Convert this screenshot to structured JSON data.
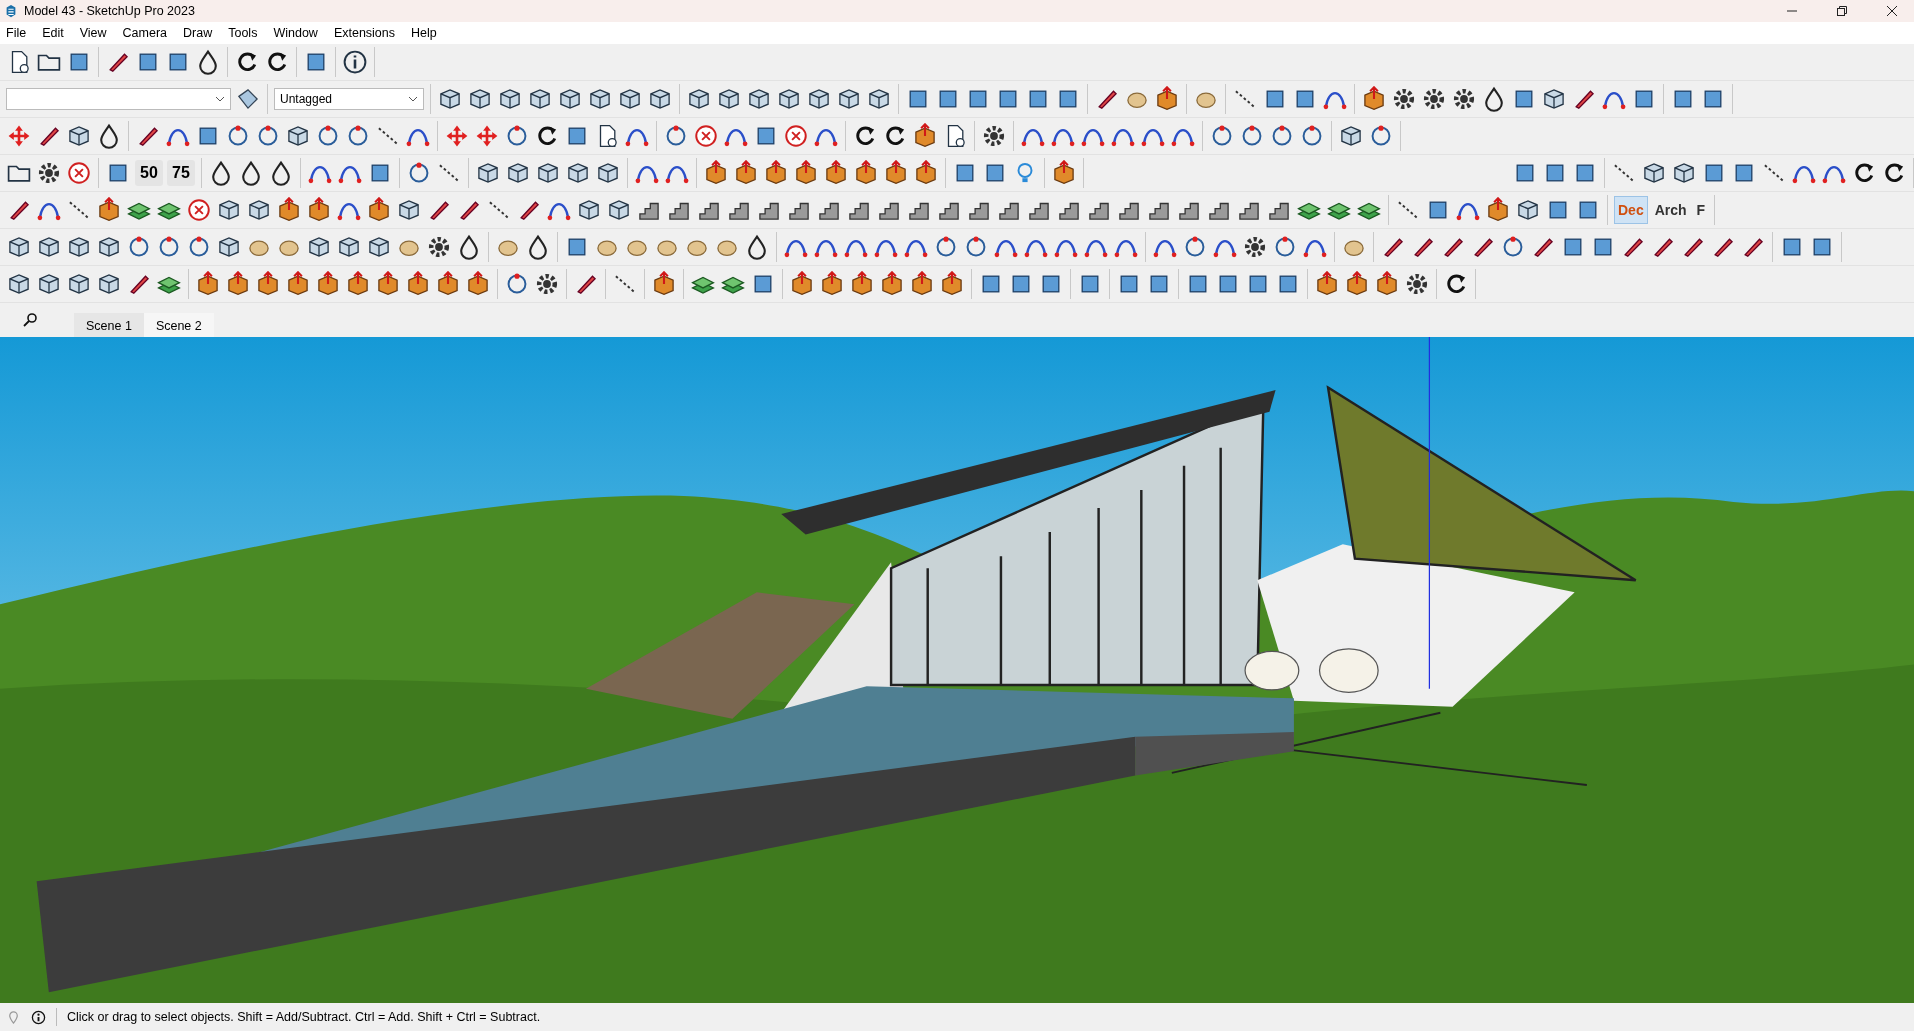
{
  "window": {
    "title": "Model 43 - SketchUp Pro 2023"
  },
  "menu": [
    "File",
    "Edit",
    "View",
    "Camera",
    "Draw",
    "Tools",
    "Window",
    "Extensions",
    "Help"
  ],
  "tag_selector": {
    "value": "Untagged"
  },
  "toolbar_labels": [
    "50",
    "75"
  ],
  "units": [
    {
      "label": "Dec",
      "selected": true
    },
    {
      "label": "Arch",
      "selected": false
    },
    {
      "label": "F",
      "selected": false
    }
  ],
  "scenes": [
    {
      "label": "Scene 1",
      "selected": false
    },
    {
      "label": "Scene 2",
      "selected": true
    }
  ],
  "status_bar": {
    "message": "Click or drag to select objects. Shift = Add/Subtract. Ctrl = Add. Shift + Ctrl = Subtract."
  }
}
